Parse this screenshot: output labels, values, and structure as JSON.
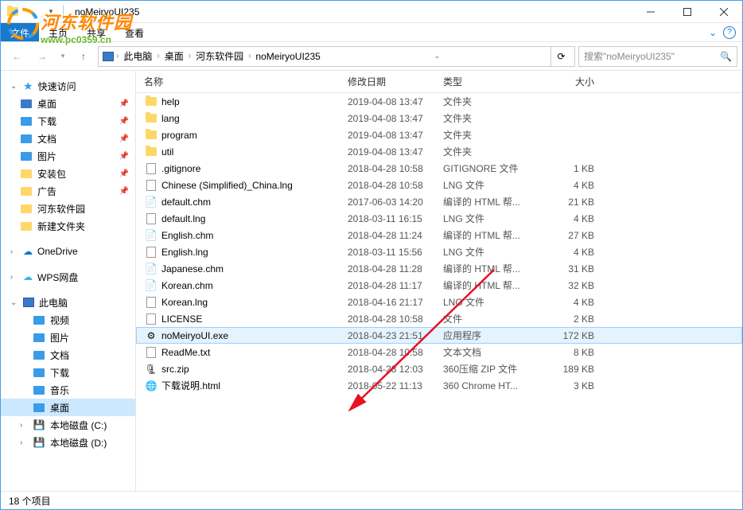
{
  "window": {
    "title": "noMeiryoUI235"
  },
  "ribbon": {
    "file": "文件",
    "tabs": [
      "主页",
      "共享",
      "查看"
    ]
  },
  "breadcrumb": {
    "segments": [
      "此电脑",
      "桌面",
      "河东软件园",
      "noMeiryoUI235"
    ]
  },
  "search": {
    "placeholder": "搜索\"noMeiryoUI235\""
  },
  "navpane": {
    "quick": {
      "label": "快速访问",
      "items": [
        {
          "label": "桌面",
          "pinned": true,
          "color": "#3a7bc8"
        },
        {
          "label": "下载",
          "pinned": true,
          "color": "#3a9be8"
        },
        {
          "label": "文档",
          "pinned": true,
          "color": "#3a9be8"
        },
        {
          "label": "图片",
          "pinned": true,
          "color": "#3a9be8"
        },
        {
          "label": "安装包",
          "pinned": true,
          "color": "#ffd768"
        },
        {
          "label": "广告",
          "pinned": true,
          "color": "#ffd768"
        },
        {
          "label": "河东软件园",
          "pinned": false,
          "color": "#ffd768"
        },
        {
          "label": "新建文件夹",
          "pinned": false,
          "color": "#ffd768"
        }
      ]
    },
    "onedrive": "OneDrive",
    "wps": "WPS网盘",
    "thispc": {
      "label": "此电脑",
      "items": [
        {
          "label": "视频"
        },
        {
          "label": "图片"
        },
        {
          "label": "文档"
        },
        {
          "label": "下载"
        },
        {
          "label": "音乐"
        },
        {
          "label": "桌面",
          "selected": true
        },
        {
          "label": "本地磁盘 (C:)"
        },
        {
          "label": "本地磁盘 (D:)"
        }
      ]
    }
  },
  "columns": {
    "name": "名称",
    "date": "修改日期",
    "type": "类型",
    "size": "大小"
  },
  "files": [
    {
      "name": "help",
      "date": "2019-04-08 13:47",
      "type": "文件夹",
      "size": "",
      "icon": "folder"
    },
    {
      "name": "lang",
      "date": "2019-04-08 13:47",
      "type": "文件夹",
      "size": "",
      "icon": "folder"
    },
    {
      "name": "program",
      "date": "2019-04-08 13:47",
      "type": "文件夹",
      "size": "",
      "icon": "folder"
    },
    {
      "name": "util",
      "date": "2019-04-08 13:47",
      "type": "文件夹",
      "size": "",
      "icon": "folder"
    },
    {
      "name": ".gitignore",
      "date": "2018-04-28 10:58",
      "type": "GITIGNORE 文件",
      "size": "1 KB",
      "icon": "file"
    },
    {
      "name": "Chinese (Simplified)_China.lng",
      "date": "2018-04-28 10:58",
      "type": "LNG 文件",
      "size": "4 KB",
      "icon": "file"
    },
    {
      "name": "default.chm",
      "date": "2017-06-03 14:20",
      "type": "编译的 HTML 帮...",
      "size": "21 KB",
      "icon": "chm"
    },
    {
      "name": "default.lng",
      "date": "2018-03-11 16:15",
      "type": "LNG 文件",
      "size": "4 KB",
      "icon": "file"
    },
    {
      "name": "English.chm",
      "date": "2018-04-28 11:24",
      "type": "编译的 HTML 帮...",
      "size": "27 KB",
      "icon": "chm"
    },
    {
      "name": "English.lng",
      "date": "2018-03-11 15:56",
      "type": "LNG 文件",
      "size": "4 KB",
      "icon": "file"
    },
    {
      "name": "Japanese.chm",
      "date": "2018-04-28 11:28",
      "type": "编译的 HTML 帮...",
      "size": "31 KB",
      "icon": "chm"
    },
    {
      "name": "Korean.chm",
      "date": "2018-04-28 11:17",
      "type": "编译的 HTML 帮...",
      "size": "32 KB",
      "icon": "chm"
    },
    {
      "name": "Korean.lng",
      "date": "2018-04-16 21:17",
      "type": "LNG 文件",
      "size": "4 KB",
      "icon": "file"
    },
    {
      "name": "LICENSE",
      "date": "2018-04-28 10:58",
      "type": "文件",
      "size": "2 KB",
      "icon": "file"
    },
    {
      "name": "noMeiryoUI.exe",
      "date": "2018-04-23 21:51",
      "type": "应用程序",
      "size": "172 KB",
      "icon": "exe",
      "highlighted": true
    },
    {
      "name": "ReadMe.txt",
      "date": "2018-04-28 10:58",
      "type": "文本文档",
      "size": "8 KB",
      "icon": "txt"
    },
    {
      "name": "src.zip",
      "date": "2018-04-28 12:03",
      "type": "360压缩 ZIP 文件",
      "size": "189 KB",
      "icon": "zip"
    },
    {
      "name": "下载说明.html",
      "date": "2018-05-22 11:13",
      "type": "360 Chrome HT...",
      "size": "3 KB",
      "icon": "html"
    }
  ],
  "statusbar": {
    "count": "18 个项目"
  },
  "watermark": {
    "text": "河东软件园",
    "url": "www.pc0359.cn"
  }
}
